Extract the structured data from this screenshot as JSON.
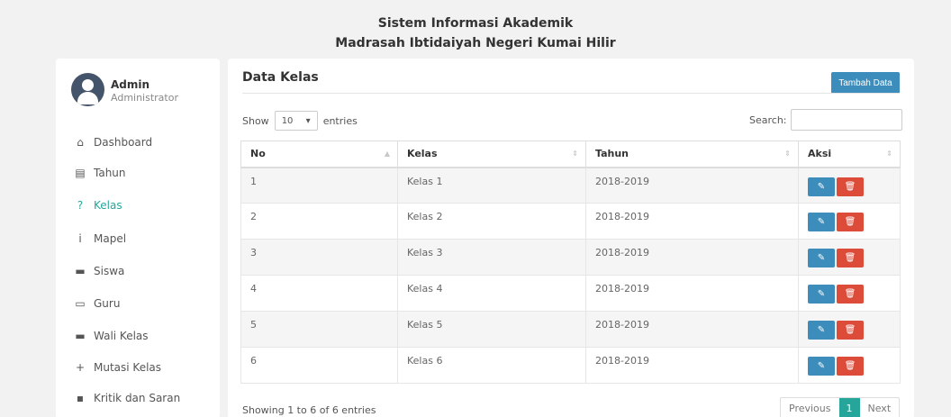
{
  "header": {
    "line1": "Sistem Informasi Akademik",
    "line2": "Madrasah Ibtidaiyah Negeri Kumai Hilir"
  },
  "user": {
    "name": "Admin",
    "role": "Administrator"
  },
  "nav": [
    {
      "label": "Dashboard",
      "icon": "home-icon",
      "glyph": "⌂"
    },
    {
      "label": "Tahun",
      "icon": "calendar-icon",
      "glyph": "▤"
    },
    {
      "label": "Kelas",
      "icon": "question-icon",
      "glyph": "?"
    },
    {
      "label": "Mapel",
      "icon": "info-icon",
      "glyph": "i"
    },
    {
      "label": "Siswa",
      "icon": "id-card-icon",
      "glyph": "▬"
    },
    {
      "label": "Guru",
      "icon": "comment-icon",
      "glyph": "▭"
    },
    {
      "label": "Wali Kelas",
      "icon": "users-icon",
      "glyph": "▬"
    },
    {
      "label": "Mutasi Kelas",
      "icon": "plus-icon",
      "glyph": "+"
    },
    {
      "label": "Kritik dan Saran",
      "icon": "message-icon",
      "glyph": "▪"
    }
  ],
  "active_nav": "Kelas",
  "accent_color": "#26a69a",
  "main": {
    "title": "Data Kelas",
    "add_button": "Tambah Data",
    "show_label": "Show",
    "entries_value": "10",
    "entries_label": "entries",
    "search_label": "Search:",
    "search_value": ""
  },
  "table": {
    "columns": [
      "No",
      "Kelas",
      "Tahun",
      "Aksi"
    ],
    "rows": [
      [
        "1",
        "Kelas 1",
        "2018-2019"
      ],
      [
        "2",
        "Kelas 2",
        "2018-2019"
      ],
      [
        "3",
        "Kelas 3",
        "2018-2019"
      ],
      [
        "4",
        "Kelas 4",
        "2018-2019"
      ],
      [
        "5",
        "Kelas 5",
        "2018-2019"
      ],
      [
        "6",
        "Kelas 6",
        "2018-2019"
      ]
    ]
  },
  "footer": {
    "info": "Showing 1 to 6 of 6 entries",
    "previous": "Previous",
    "current_page": "1",
    "next": "Next"
  }
}
